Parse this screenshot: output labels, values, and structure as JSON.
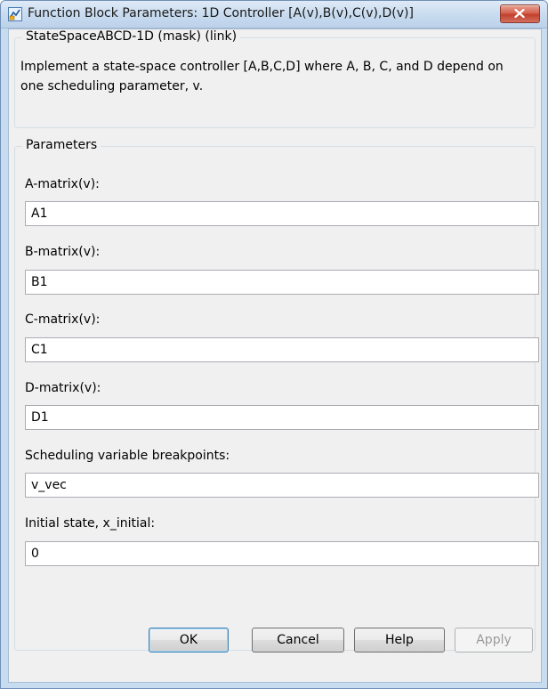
{
  "window": {
    "title": "Function Block Parameters: 1D Controller [A(v),B(v),C(v),D(v)]"
  },
  "mask": {
    "header": "StateSpaceABCD-1D (mask) (link)",
    "description": "Implement a state-space controller [A,B,C,D] where A, B, C, and D depend on one scheduling parameter, v."
  },
  "parameters": {
    "legend": "Parameters",
    "fields": [
      {
        "label": "A-matrix(v):",
        "value": "A1"
      },
      {
        "label": "B-matrix(v):",
        "value": "B1"
      },
      {
        "label": "C-matrix(v):",
        "value": "C1"
      },
      {
        "label": "D-matrix(v):",
        "value": "D1"
      },
      {
        "label": "Scheduling variable breakpoints:",
        "value": "v_vec"
      },
      {
        "label": "Initial state, x_initial:",
        "value": "0"
      }
    ]
  },
  "buttons": {
    "ok": "OK",
    "cancel": "Cancel",
    "help": "Help",
    "apply": "Apply"
  },
  "icons": {
    "app": "simulink-block-icon",
    "close": "close-icon"
  },
  "colors": {
    "close_button": "#c8432f",
    "frame": "#c8dcf0",
    "client_bg": "#f0f0f0"
  }
}
